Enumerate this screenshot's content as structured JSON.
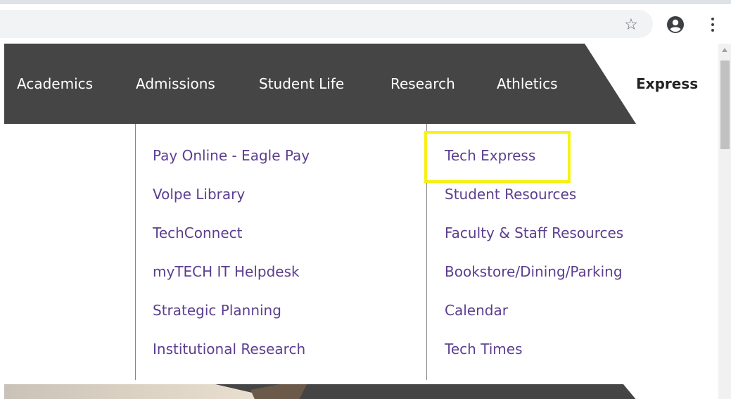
{
  "browser": {
    "star_glyph": "☆",
    "profile_icon": "account-circle-icon",
    "menu_icon": "more-vertical-icon"
  },
  "nav": {
    "items": [
      {
        "label": "Academics"
      },
      {
        "label": "Admissions"
      },
      {
        "label": "Student Life"
      },
      {
        "label": "Research"
      },
      {
        "label": "Athletics"
      },
      {
        "label": "Express"
      }
    ]
  },
  "dropdown": {
    "left_column": [
      {
        "label": "Pay Online - Eagle Pay"
      },
      {
        "label": "Volpe Library"
      },
      {
        "label": "TechConnect"
      },
      {
        "label": "myTECH IT Helpdesk"
      },
      {
        "label": "Strategic Planning"
      },
      {
        "label": "Institutional Research"
      }
    ],
    "right_column": [
      {
        "label": "Tech Express"
      },
      {
        "label": "Student Resources"
      },
      {
        "label": "Faculty & Staff Resources"
      },
      {
        "label": "Bookstore/Dining/Parking"
      },
      {
        "label": "Calendar"
      },
      {
        "label": "Tech Times"
      }
    ]
  },
  "colors": {
    "nav_background": "#454545",
    "link_purple": "#5c3e8f",
    "highlight_yellow": "#f5f11a"
  }
}
